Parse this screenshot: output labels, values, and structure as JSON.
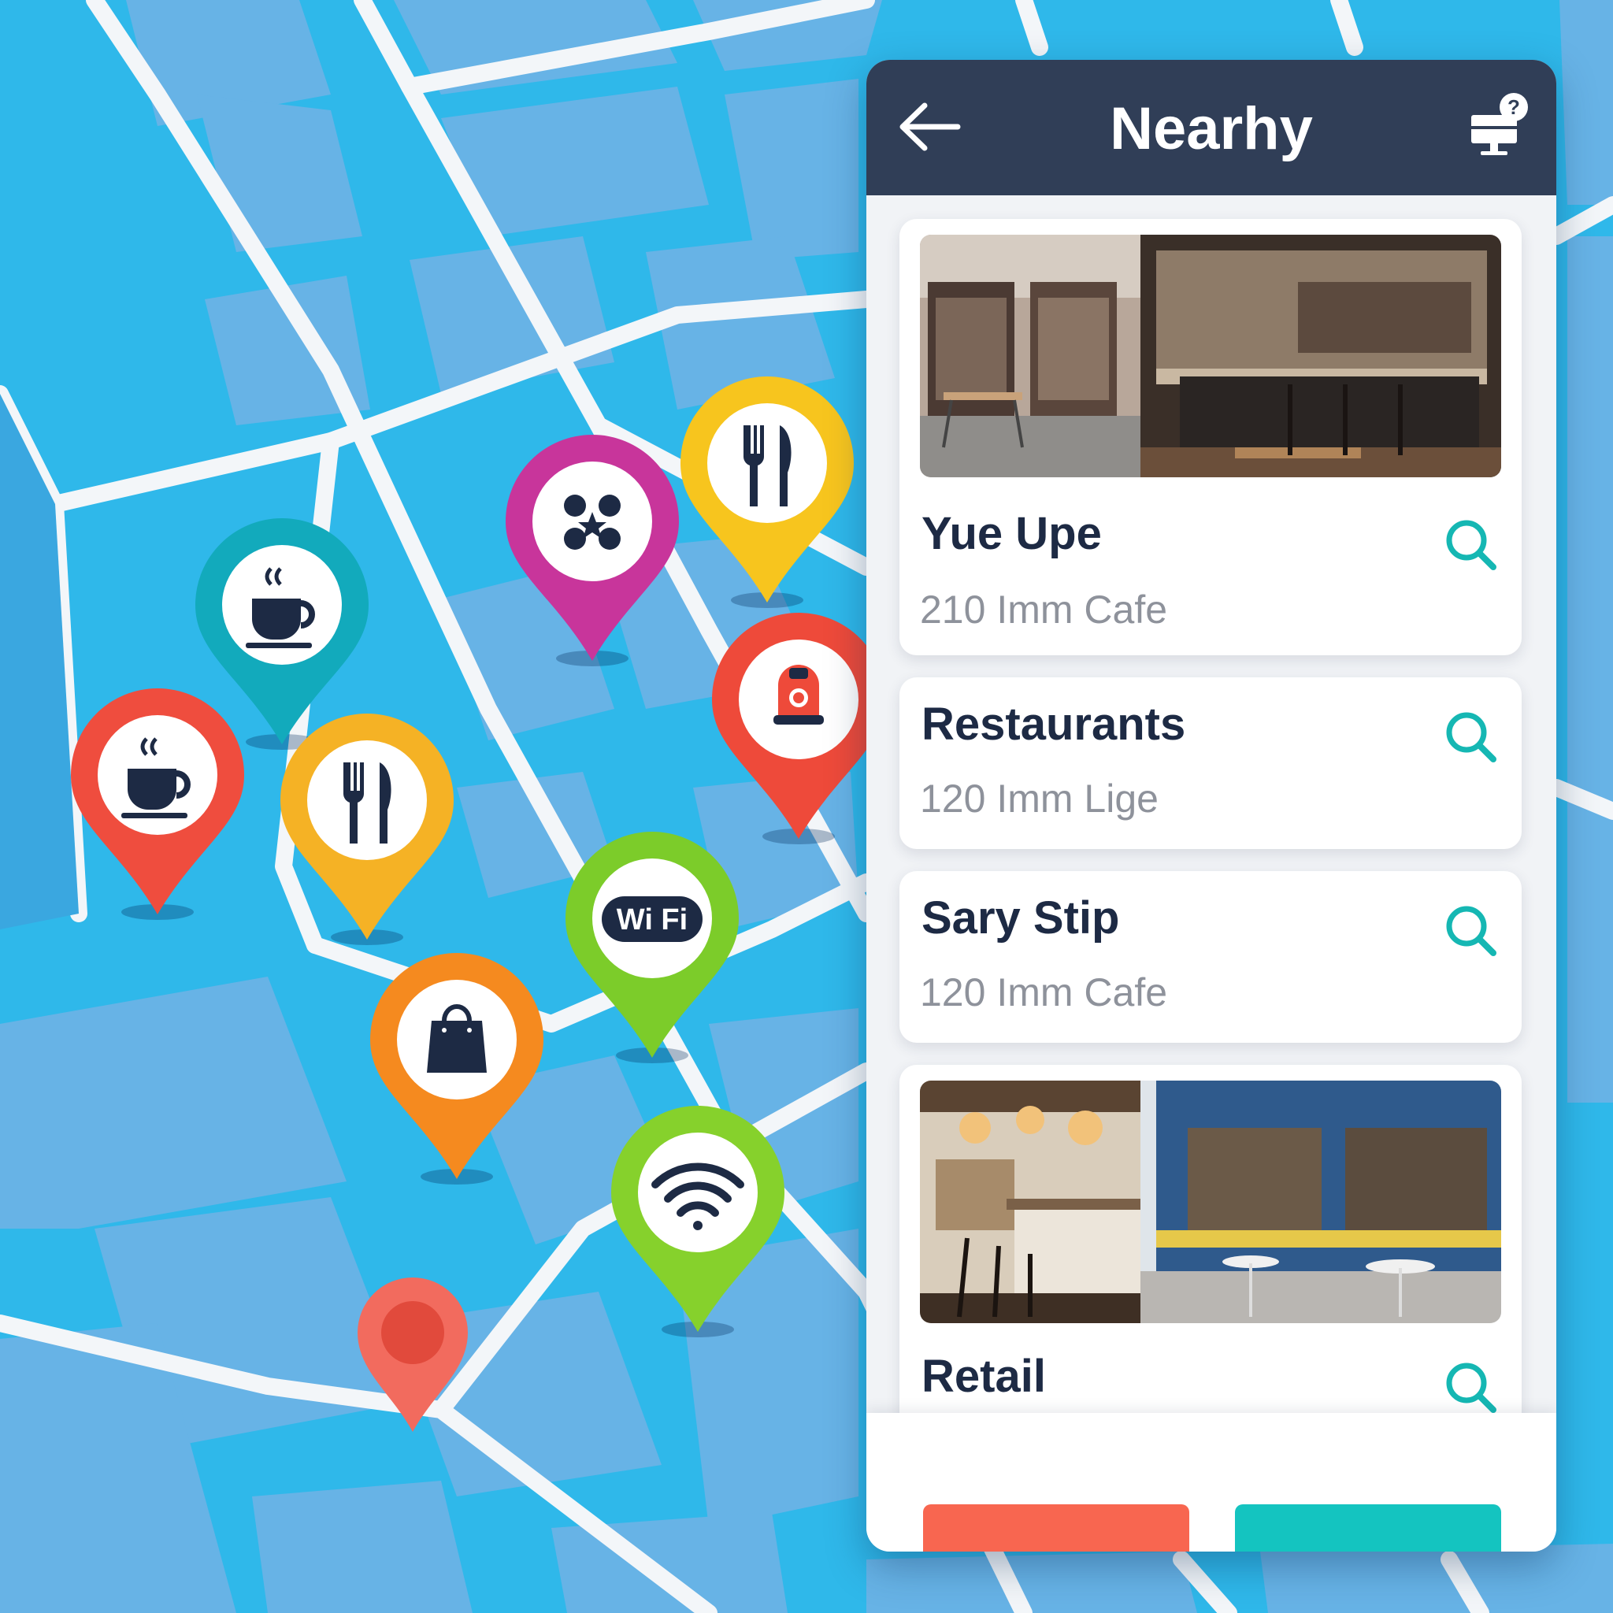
{
  "header": {
    "title": "Nearhy",
    "back_icon": "arrow-left-icon",
    "help_icon": "computer-help-icon"
  },
  "places": [
    {
      "title": "Yue Upe",
      "subtitle": "210 Imm Cafe",
      "has_image": true,
      "image": "cafe-storefront-and-bar-interior"
    },
    {
      "title": "Restaurants",
      "subtitle": "120 Imm Lige",
      "has_image": false
    },
    {
      "title": "Sary Stip",
      "subtitle": "120 Imm Cafe",
      "has_image": false
    },
    {
      "title": "Retail",
      "subtitle": "",
      "has_image": true,
      "image": "cafe-counter-and-blue-storefront"
    }
  ],
  "footer": {
    "primary_color": "#f86650",
    "secondary_color": "#14c4c0"
  },
  "map_pins": [
    {
      "category": "coffee",
      "icon": "coffee-cup-icon",
      "color": "#12aabc"
    },
    {
      "category": "coffee",
      "icon": "coffee-cup-icon",
      "color": "#ef4d3e"
    },
    {
      "category": "restaurant",
      "icon": "fork-knife-icon",
      "color": "#f5b225"
    },
    {
      "category": "entertainment",
      "icon": "dots-icon",
      "color": "#c8359b"
    },
    {
      "category": "restaurant",
      "icon": "fork-knife-icon",
      "color": "#f7c51e"
    },
    {
      "category": "transit",
      "icon": "person-icon",
      "color": "#ee4a3a"
    },
    {
      "category": "wifi",
      "icon": "wifi-text-icon",
      "color": "#7ccc2a"
    },
    {
      "category": "shopping",
      "icon": "shopping-bag-icon",
      "color": "#f58a1f"
    },
    {
      "category": "wifi",
      "icon": "wifi-icon",
      "color": "#86d12c"
    },
    {
      "category": "current-location",
      "icon": "location-dot-icon",
      "color": "#f26b5e"
    }
  ],
  "colors": {
    "header": "#303e57",
    "map_water": "#2fb8ea",
    "map_block": "#67b3e6",
    "accent": "#15b7b3"
  }
}
